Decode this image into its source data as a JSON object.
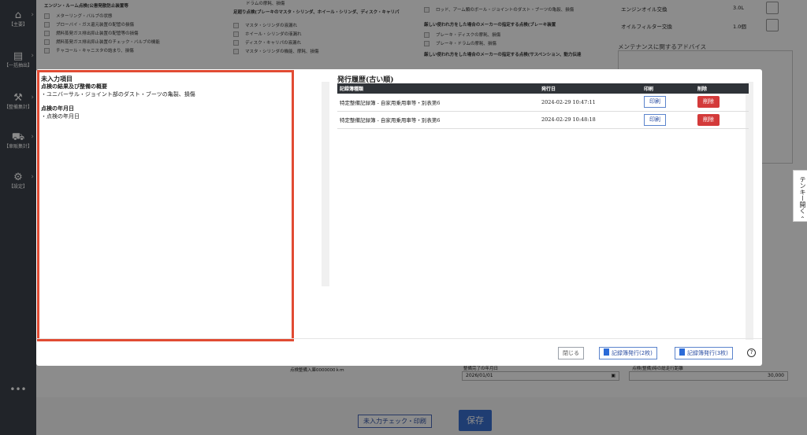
{
  "sidebar": {
    "items": [
      {
        "label": "【主要】",
        "icon": "home-icon",
        "glyph": "⌂"
      },
      {
        "label": "【一括抽出】",
        "icon": "extract-icon",
        "glyph": "▤"
      },
      {
        "label": "【整備集計】",
        "icon": "tools-icon",
        "glyph": "⚒"
      },
      {
        "label": "【車販集計】",
        "icon": "car-icon",
        "glyph": "⛟"
      },
      {
        "label": "【設定】",
        "icon": "gear-icon",
        "glyph": "⚙"
      }
    ],
    "more": "•••"
  },
  "background": {
    "col1": {
      "heading": "エンジン・ルーム点検(公害発散防止装置等",
      "items": [
        "メターリング・バルブの状態",
        "ブローバイ・ガス還元装置の配管の損傷",
        "燃料蒸発ガス排出抑止装置の配管等の損傷",
        "燃料蒸発ガス排出抑止装置のチェック・バルブの機能",
        "チャコール・キャニスタの詰まり、損傷"
      ]
    },
    "col2": {
      "top": "ドラムの摩耗、損傷",
      "heading": "足廻り点検(ブレーキのマスタ・シリンダ、ホイール・シリンダ、ディスク・キャリパ",
      "items": [
        "マスタ・シリンダの液漏れ",
        "ホイール・シリンダの液漏れ",
        "ディスク・キャリパの液漏れ",
        "マスタ・シリンダの機能、摩耗、損傷"
      ]
    },
    "col3": {
      "top": "ロッド、アーム類のボール・ジョイントのダスト・ブーツの亀裂、損傷",
      "heading": "厳しい使われ方をした場合のメーカーの指定する点検(ブレーキ装置",
      "items": [
        "ブレーキ・ディスクの摩耗、損傷",
        "ブレーキ・ドラムの摩耗、損傷"
      ],
      "heading2": "厳しい使われ方をした場合のメーカーの指定する点検(サスペンション、動力伝達"
    },
    "right_panel": {
      "rows": [
        {
          "name": "エンジンオイル交換",
          "value": "3.0L"
        },
        {
          "name": "オイルフィルター交換",
          "value": "1.0個"
        }
      ],
      "advice_label": "メンテナンスに関するアドバイス"
    },
    "keypad_tab": "テンキー開く ‹",
    "bottom": {
      "left_label": "点検整備入庫0000000ｋｍ",
      "mid_label": "整備完了の年月日",
      "date_value": "2026/01/01",
      "right_label": "点検(整備)時の総走行距離",
      "distance_value": "30,000"
    },
    "buttons": {
      "check_print": "未入力チェック・印刷",
      "save": "保存"
    }
  },
  "modal": {
    "missing": {
      "title": "未入力項目",
      "groups": [
        {
          "name": "点検の結果及び整備の概要",
          "items": [
            "・ユニバーサル・ジョイント部のダスト・ブーツの亀裂、損傷"
          ]
        },
        {
          "name": "点検の年月日",
          "items": [
            "・点検の年月日"
          ]
        }
      ]
    },
    "history": {
      "title": "発行履歴(古い順)",
      "columns": [
        "記録簿種類",
        "発行日",
        "印刷",
        "削除"
      ],
      "rows": [
        {
          "type": "特定整備記録簿 - 自家用乗用車等・別表第6",
          "date": "2024-02-29 10:47:11",
          "print": "印刷",
          "delete": "削除"
        },
        {
          "type": "特定整備記録簿 - 自家用乗用車等・別表第6",
          "date": "2024-02-29 10:48:18",
          "print": "印刷",
          "delete": "削除"
        }
      ]
    },
    "footer": {
      "close": "閉じる",
      "issue2": "記録簿発行(2枚)",
      "issue3": "記録簿発行(3枚)",
      "help": "?"
    }
  },
  "colors": {
    "sidebar": "#3d434b",
    "highlight_border": "#e14b33",
    "delete_button": "#d33a3a",
    "primary": "#3a6fd0"
  }
}
